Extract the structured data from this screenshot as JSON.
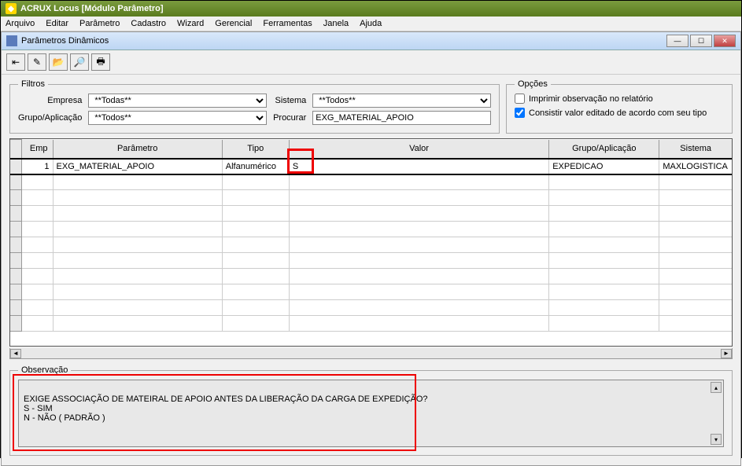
{
  "window": {
    "title": "ACRUX Locus [Módulo Parâmetro]"
  },
  "menu": {
    "items": [
      "Arquivo",
      "Editar",
      "Parâmetro",
      "Cadastro",
      "Wizard",
      "Gerencial",
      "Ferramentas",
      "Janela",
      "Ajuda"
    ]
  },
  "subwindow": {
    "title": "Parâmetros Dinâmicos"
  },
  "filters": {
    "legend": "Filtros",
    "empresa_label": "Empresa",
    "empresa_value": "**Todas**",
    "sistema_label": "Sistema",
    "sistema_value": "**Todos**",
    "grupo_label": "Grupo/Aplicação",
    "grupo_value": "**Todos**",
    "procurar_label": "Procurar",
    "procurar_value": "EXG_MATERIAL_APOIO"
  },
  "options": {
    "legend": "Opções",
    "imprimir_label": "Imprimir observação no relatório",
    "imprimir_checked": false,
    "consistir_label": "Consistir valor editado de acordo com seu tipo",
    "consistir_checked": true
  },
  "table": {
    "headers": {
      "emp": "Emp",
      "parametro": "Parâmetro",
      "tipo": "Tipo",
      "valor": "Valor",
      "grupo": "Grupo/Aplicação",
      "sistema": "Sistema"
    },
    "rows": [
      {
        "emp": "1",
        "parametro": "EXG_MATERIAL_APOIO",
        "tipo": "Alfanumérico",
        "valor": "S",
        "grupo": "EXPEDICAO",
        "sistema": "MAXLOGISTICA"
      }
    ]
  },
  "observacao": {
    "legend": "Observação",
    "text": "EXIGE ASSOCIAÇÃO DE MATEIRAL DE APOIO ANTES DA LIBERAÇÃO DA CARGA DE EXPEDIÇÃO?\nS - SIM\nN - NÃO ( PADRÃO )"
  }
}
